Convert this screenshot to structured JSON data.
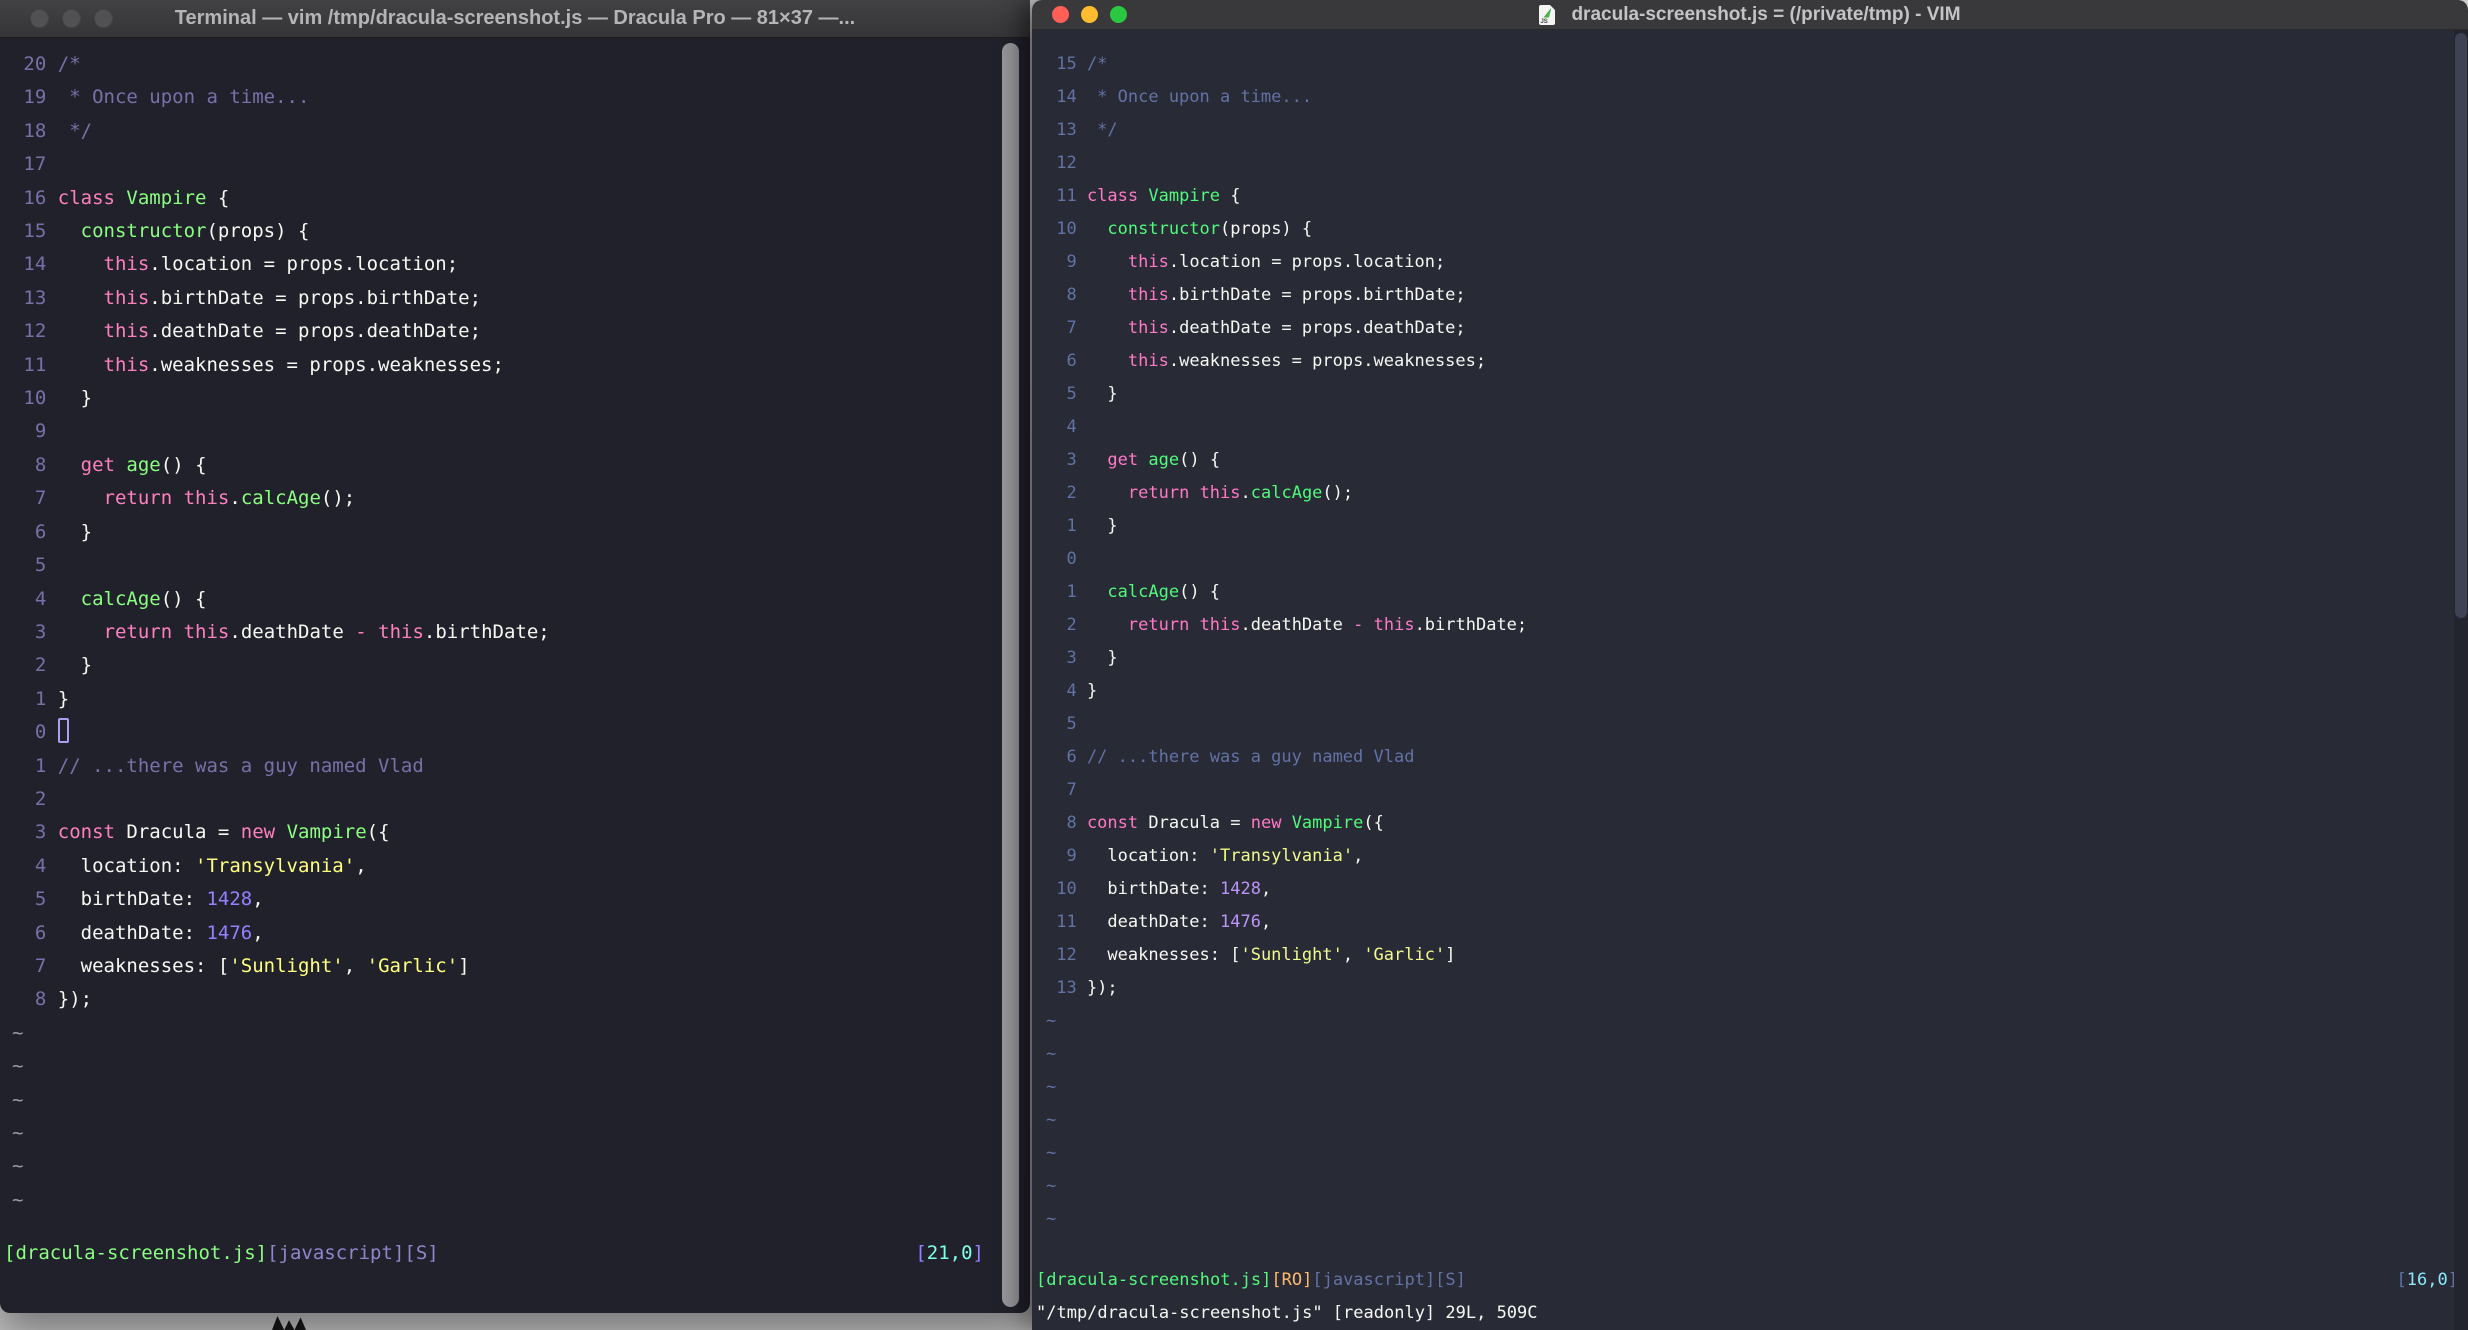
{
  "left_window": {
    "title": "Terminal — vim /tmp/dracula-screenshot.js — Dracula Pro — 81×37 —...",
    "window_state": "inactive",
    "gutter": [
      "20",
      "19",
      "18",
      "17",
      "16",
      "15",
      "14",
      "13",
      "12",
      "11",
      "10",
      "9",
      "8",
      "7",
      "6",
      "5",
      "4",
      "3",
      "2",
      "1",
      "0",
      "1",
      "2",
      "3",
      "4",
      "5",
      "6",
      "7",
      "8"
    ],
    "cursor_line_index": 20,
    "cursor_style": "hollow",
    "tilde_count": 6,
    "tilde_char": "~",
    "status_segments": [
      [
        "g",
        "[dracula-screenshot.js]"
      ],
      [
        "sl",
        "[javascript][S]"
      ]
    ],
    "position_segments": [
      [
        "n",
        "["
      ],
      [
        "cy",
        "21,0"
      ],
      [
        "n",
        "]"
      ]
    ],
    "colors": {
      "bg": "#21212b",
      "fg": "#f8f8f2",
      "comment": "#7970a9",
      "linenr": "#7970a9",
      "pink": "#ff80bf",
      "green": "#8aff80",
      "yellow": "#ffff80",
      "purple": "#9580ff",
      "cyan": "#80ffea",
      "orange": "#ffca80",
      "tilde": "#9d9ca4",
      "statuslabel": "#8f87cc"
    }
  },
  "right_window": {
    "title": "dracula-screenshot.js = (/private/tmp) - VIM",
    "window_state": "active",
    "file_icon": "js-file-icon",
    "gutter": [
      "15",
      "14",
      "13",
      "12",
      "11",
      "10",
      "9",
      "8",
      "7",
      "6",
      "5",
      "4",
      "3",
      "2",
      "1",
      "0",
      "1",
      "2",
      "3",
      "4",
      "5",
      "6",
      "7",
      "8",
      "9",
      "10",
      "11",
      "12",
      "13"
    ],
    "cursor_line_index": 15,
    "cursor_style": "none",
    "tilde_count": 7,
    "tilde_char": "~",
    "status_segments": [
      [
        "g",
        "[dracula-screenshot.js]"
      ],
      [
        "o",
        "[RO]"
      ],
      [
        "sl",
        "[javascript][S]"
      ]
    ],
    "position_segments": [
      [
        "sl",
        "["
      ],
      [
        "cy",
        "16,0"
      ],
      [
        "sl",
        "]"
      ]
    ],
    "cmdline": "\"/tmp/dracula-screenshot.js\" [readonly] 29L, 509C",
    "colors": {
      "bg": "#282a36",
      "fg": "#f8f8f2",
      "comment": "#6272a4",
      "linenr": "#6272a4",
      "pink": "#ff79c6",
      "green": "#50fa7b",
      "yellow": "#f1fa8c",
      "purple": "#bd93f9",
      "cyan": "#8be9fd",
      "orange": "#ffb86c",
      "tilde": "#6272a4",
      "statuslabel": "#6272a4"
    }
  },
  "code_lines": [
    {
      "seg": [
        [
          "c",
          "/*"
        ]
      ]
    },
    {
      "seg": [
        [
          "c",
          " * Once upon a time..."
        ]
      ]
    },
    {
      "seg": [
        [
          "c",
          " */"
        ]
      ]
    },
    {
      "seg": []
    },
    {
      "seg": [
        [
          "k",
          "class"
        ],
        [
          "p",
          " "
        ],
        [
          "g",
          "Vampire"
        ],
        [
          "p",
          " {"
        ]
      ]
    },
    {
      "seg": [
        [
          "p",
          "  "
        ],
        [
          "g",
          "constructor"
        ],
        [
          "p",
          "(props) {"
        ]
      ]
    },
    {
      "seg": [
        [
          "p",
          "    "
        ],
        [
          "k",
          "this"
        ],
        [
          "p",
          ".location = props.location;"
        ]
      ]
    },
    {
      "seg": [
        [
          "p",
          "    "
        ],
        [
          "k",
          "this"
        ],
        [
          "p",
          ".birthDate = props.birthDate;"
        ]
      ]
    },
    {
      "seg": [
        [
          "p",
          "    "
        ],
        [
          "k",
          "this"
        ],
        [
          "p",
          ".deathDate = props.deathDate;"
        ]
      ]
    },
    {
      "seg": [
        [
          "p",
          "    "
        ],
        [
          "k",
          "this"
        ],
        [
          "p",
          ".weaknesses = props.weaknesses;"
        ]
      ]
    },
    {
      "seg": [
        [
          "p",
          "  }"
        ]
      ]
    },
    {
      "seg": []
    },
    {
      "seg": [
        [
          "p",
          "  "
        ],
        [
          "k",
          "get"
        ],
        [
          "p",
          " "
        ],
        [
          "g",
          "age"
        ],
        [
          "p",
          "() {"
        ]
      ]
    },
    {
      "seg": [
        [
          "p",
          "    "
        ],
        [
          "k",
          "return"
        ],
        [
          "p",
          " "
        ],
        [
          "k",
          "this"
        ],
        [
          "p",
          "."
        ],
        [
          "g",
          "calcAge"
        ],
        [
          "p",
          "();"
        ]
      ]
    },
    {
      "seg": [
        [
          "p",
          "  }"
        ]
      ]
    },
    {
      "seg": []
    },
    {
      "seg": [
        [
          "p",
          "  "
        ],
        [
          "g",
          "calcAge"
        ],
        [
          "p",
          "() {"
        ]
      ]
    },
    {
      "seg": [
        [
          "p",
          "    "
        ],
        [
          "k",
          "return"
        ],
        [
          "p",
          " "
        ],
        [
          "k",
          "this"
        ],
        [
          "p",
          ".deathDate "
        ],
        [
          "k",
          "-"
        ],
        [
          "p",
          " "
        ],
        [
          "k",
          "this"
        ],
        [
          "p",
          ".birthDate;"
        ]
      ]
    },
    {
      "seg": [
        [
          "p",
          "  }"
        ]
      ]
    },
    {
      "seg": [
        [
          "p",
          "}"
        ]
      ]
    },
    {
      "seg": []
    },
    {
      "seg": [
        [
          "c",
          "// ...there was a guy named Vlad"
        ]
      ]
    },
    {
      "seg": []
    },
    {
      "seg": [
        [
          "k",
          "const"
        ],
        [
          "p",
          " Dracula = "
        ],
        [
          "k",
          "new"
        ],
        [
          "p",
          " "
        ],
        [
          "g",
          "Vampire"
        ],
        [
          "p",
          "({"
        ]
      ]
    },
    {
      "seg": [
        [
          "p",
          "  location: "
        ],
        [
          "y",
          "'Transylvania'"
        ],
        [
          "p",
          ","
        ]
      ]
    },
    {
      "seg": [
        [
          "p",
          "  birthDate: "
        ],
        [
          "n",
          "1428"
        ],
        [
          "p",
          ","
        ]
      ]
    },
    {
      "seg": [
        [
          "p",
          "  deathDate: "
        ],
        [
          "n",
          "1476"
        ],
        [
          "p",
          ","
        ]
      ]
    },
    {
      "seg": [
        [
          "p",
          "  weaknesses: ["
        ],
        [
          "y",
          "'Sunlight'"
        ],
        [
          "p",
          ", "
        ],
        [
          "y",
          "'Garlic'"
        ],
        [
          "p",
          "]"
        ]
      ]
    },
    {
      "seg": [
        [
          "p",
          "});"
        ]
      ]
    }
  ]
}
